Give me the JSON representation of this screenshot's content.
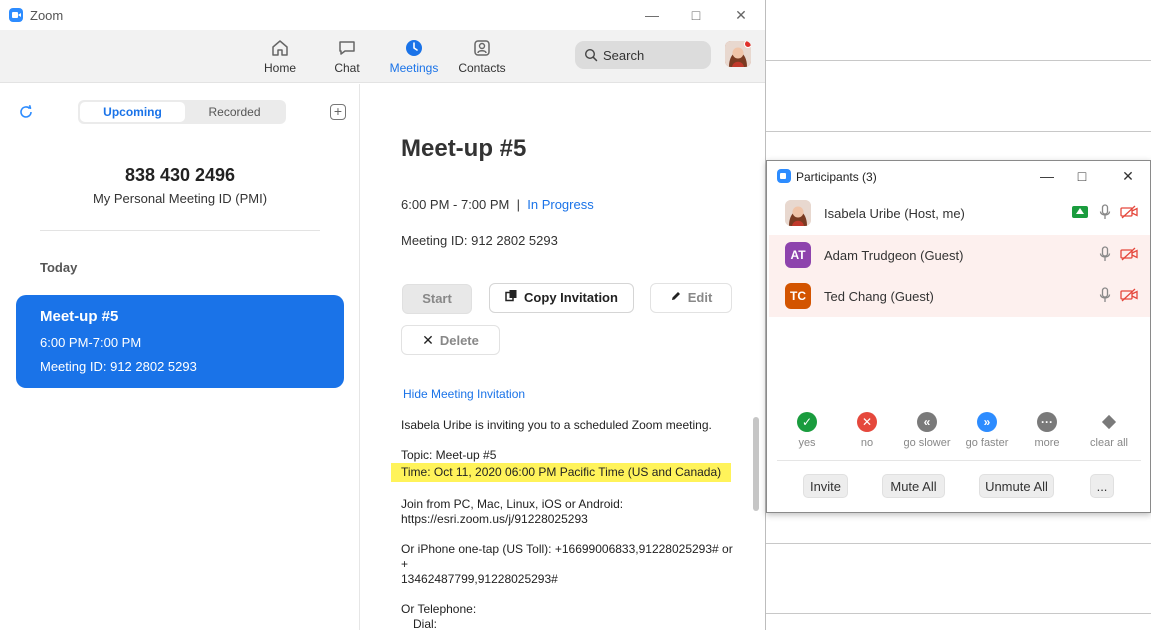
{
  "window": {
    "title": "Zoom"
  },
  "nav": {
    "items": [
      {
        "label": "Home",
        "icon": "home-icon"
      },
      {
        "label": "Chat",
        "icon": "chat-icon"
      },
      {
        "label": "Meetings",
        "icon": "clock-icon",
        "active": true
      },
      {
        "label": "Contacts",
        "icon": "contacts-icon"
      }
    ],
    "search_label": "Search"
  },
  "sidebar": {
    "tabs": {
      "upcoming": "Upcoming",
      "recorded": "Recorded"
    },
    "pmi_number": "838 430 2496",
    "pmi_label": "My Personal Meeting ID (PMI)",
    "section_label": "Today",
    "meeting": {
      "title": "Meet-up #5",
      "time": "6:00 PM-7:00 PM",
      "id_text": "Meeting ID: 912 2802 5293"
    }
  },
  "detail": {
    "title": "Meet-up #5",
    "time": "6:00 PM - 7:00 PM",
    "separator": "|",
    "status": "In Progress",
    "meeting_id": "Meeting ID: 912 2802 5293",
    "buttons": {
      "start": "Start",
      "copy": "Copy Invitation",
      "edit": "Edit",
      "delete": "Delete"
    },
    "hide_link": "Hide Meeting Invitation",
    "invitation": {
      "intro": "Isabela Uribe is inviting you to a scheduled Zoom meeting.",
      "topic": "Topic: Meet-up #5",
      "time": "Time: Oct 11, 2020 06:00 PM Pacific Time (US and Canada)",
      "join_label": "Join from PC, Mac, Linux, iOS or Android:",
      "join_url": "https://esri.zoom.us/j/91228025293",
      "iphone_line1": "Or iPhone one-tap (US Toll):  +16699006833,91228025293#  or +",
      "iphone_line2": "13462487799,91228025293#",
      "telephone": "Or Telephone:",
      "dial": "Dial:"
    }
  },
  "participants": {
    "title": "Participants (3)",
    "people": [
      {
        "name": "Isabela Uribe (Host, me)",
        "initials": "",
        "color": "#c9785e",
        "sharing": true
      },
      {
        "name": "Adam Trudgeon (Guest)",
        "initials": "AT",
        "color": "#8e44ad",
        "sharing": false
      },
      {
        "name": "Ted Chang (Guest)",
        "initials": "TC",
        "color": "#d35400",
        "sharing": false
      }
    ],
    "reactions": [
      {
        "label": "yes",
        "color": "#1a9c3e"
      },
      {
        "label": "no",
        "color": "#e5483c"
      },
      {
        "label": "go slower",
        "color": "#7a7a7a"
      },
      {
        "label": "go faster",
        "color": "#2D8CFF"
      },
      {
        "label": "more",
        "color": "#7a7a7a"
      },
      {
        "label": "clear all",
        "color": "#7a7a7a"
      }
    ],
    "buttons": {
      "invite": "Invite",
      "mute_all": "Mute All",
      "unmute_all": "Unmute All",
      "more": "..."
    }
  }
}
